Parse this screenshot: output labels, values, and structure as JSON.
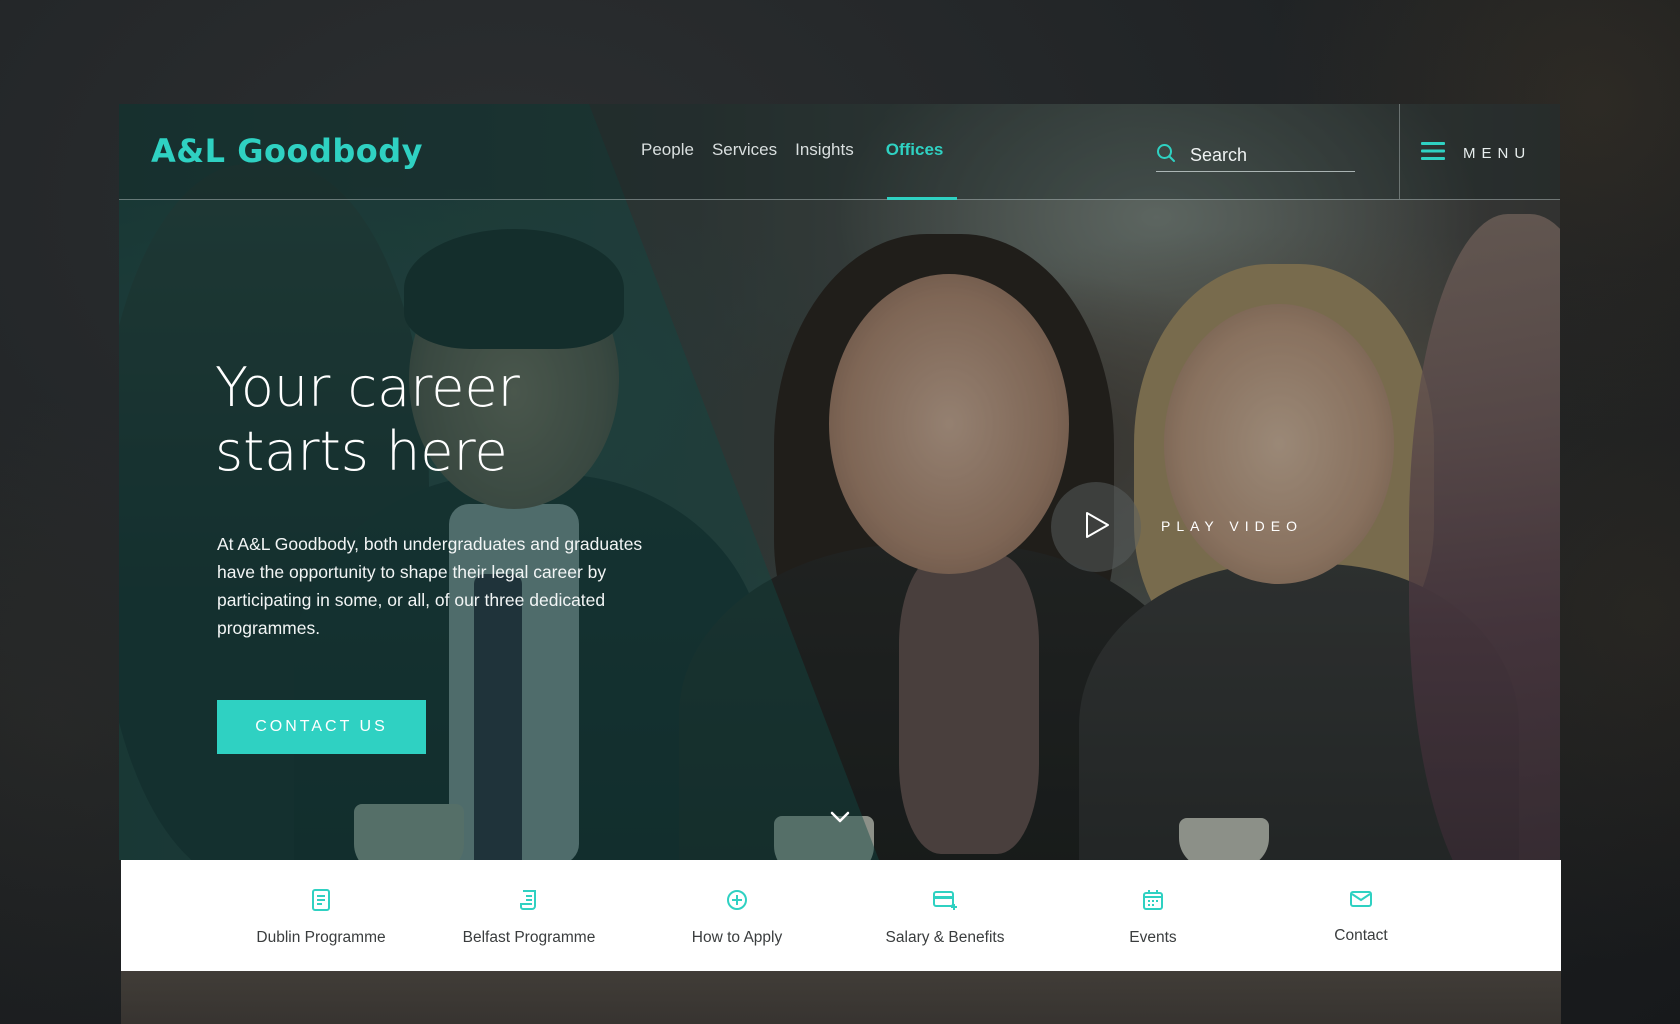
{
  "header": {
    "logo": "A&L Goodbody",
    "nav": [
      {
        "label": "People"
      },
      {
        "label": "Services"
      },
      {
        "label": "Insights"
      },
      {
        "label": "Offices",
        "active": true
      }
    ],
    "search": {
      "placeholder": "Search"
    },
    "menu_label": "MENU"
  },
  "hero": {
    "title_line1": "Your career",
    "title_line2": "starts here",
    "body": "At A&L Goodbody, both undergraduates and graduates have the opportunity to shape their legal career by participating in some, or all, of our three dedicated programmes.",
    "cta_label": "CONTACT US",
    "video_label": "PLAY VIDEO"
  },
  "quick_links": [
    {
      "label": "Dublin Programme",
      "icon": "document-list-icon"
    },
    {
      "label": "Belfast Programme",
      "icon": "scroll-document-icon"
    },
    {
      "label": "How to Apply",
      "icon": "plus-circle-icon"
    },
    {
      "label": "Salary & Benefits",
      "icon": "card-plus-icon"
    },
    {
      "label": "Events",
      "icon": "calendar-icon"
    },
    {
      "label": "Contact",
      "icon": "mail-icon"
    }
  ],
  "colors": {
    "accent": "#2fd1c2",
    "background": "#1f2224",
    "strip_background": "#ffffff",
    "text_dark": "#3a3d3e"
  }
}
